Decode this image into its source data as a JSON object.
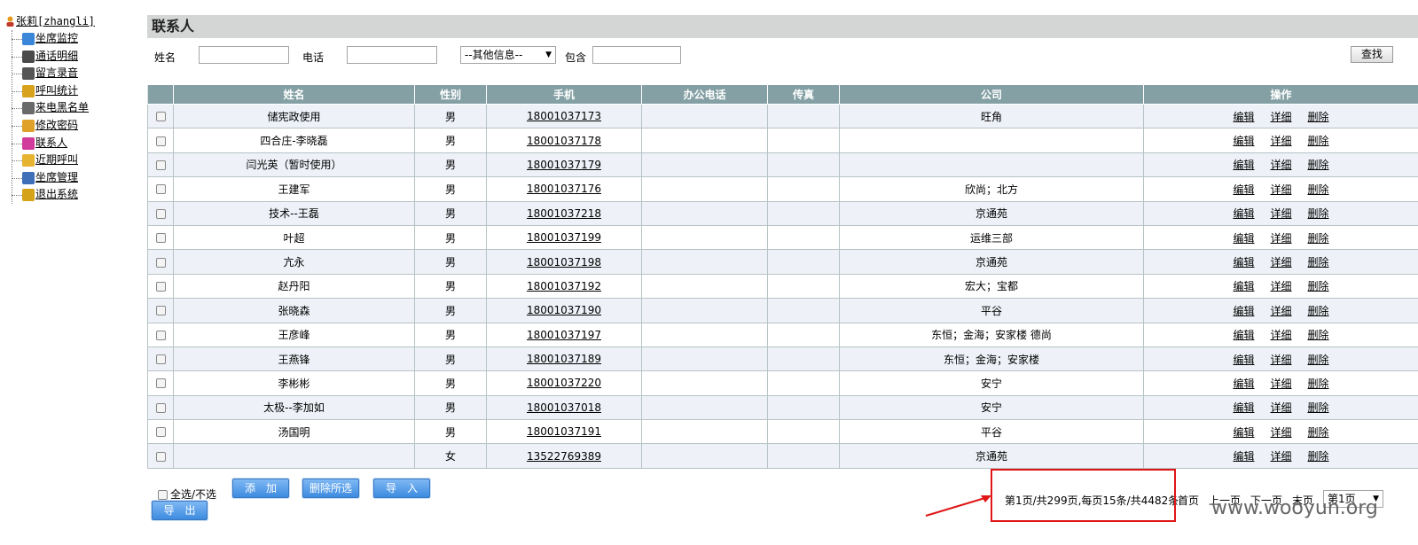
{
  "sidebar": {
    "root": "张莉[zhangli]",
    "items": [
      {
        "label": "坐席监控",
        "icon": "speaker-icon",
        "color": "#3a86d9"
      },
      {
        "label": "通话明细",
        "icon": "phone-icon",
        "color": "#4a4a4a"
      },
      {
        "label": "留言录音",
        "icon": "notebook-icon",
        "color": "#555555"
      },
      {
        "label": "呼叫统计",
        "icon": "chart-icon",
        "color": "#d9a21c"
      },
      {
        "label": "来电黑名单",
        "icon": "blacklist-icon",
        "color": "#6a6a6a"
      },
      {
        "label": "修改密码",
        "icon": "key-icon",
        "color": "#e0a12a"
      },
      {
        "label": "联系人",
        "icon": "contacts-icon",
        "color": "#d13b9c"
      },
      {
        "label": "近期呼叫",
        "icon": "folder-icon",
        "color": "#e6b430"
      },
      {
        "label": "坐席管理",
        "icon": "people-icon",
        "color": "#3f6fb8"
      },
      {
        "label": "退出系统",
        "icon": "exit-icon",
        "color": "#d4a317"
      }
    ]
  },
  "main": {
    "title": "联系人",
    "search": {
      "name_label": "姓名",
      "phone_label": "电话",
      "other_select": "--其他信息--",
      "contains_label": "包含",
      "find_button": "查找"
    },
    "table": {
      "headers": [
        "姓名",
        "性别",
        "手机",
        "办公电话",
        "传真",
        "公司",
        "操作"
      ],
      "actions": [
        "编辑",
        "详细",
        "删除"
      ],
      "rows": [
        {
          "name": "储宪政使用",
          "gender": "男",
          "mobile": "18001037173",
          "office": "",
          "fax": "",
          "company": "旺角"
        },
        {
          "name": "四合庄-李晓磊",
          "gender": "男",
          "mobile": "18001037178",
          "office": "",
          "fax": "",
          "company": ""
        },
        {
          "name": "闫光英（暂时使用）",
          "gender": "男",
          "mobile": "18001037179",
          "office": "",
          "fax": "",
          "company": ""
        },
        {
          "name": "王建军",
          "gender": "男",
          "mobile": "18001037176",
          "office": "",
          "fax": "",
          "company": "欣尚；北方"
        },
        {
          "name": "技术--王磊",
          "gender": "男",
          "mobile": "18001037218",
          "office": "",
          "fax": "",
          "company": "京通苑"
        },
        {
          "name": "叶超",
          "gender": "男",
          "mobile": "18001037199",
          "office": "",
          "fax": "",
          "company": "运维三部"
        },
        {
          "name": "亢永",
          "gender": "男",
          "mobile": "18001037198",
          "office": "",
          "fax": "",
          "company": "京通苑"
        },
        {
          "name": "赵丹阳",
          "gender": "男",
          "mobile": "18001037192",
          "office": "",
          "fax": "",
          "company": "宏大；宝都"
        },
        {
          "name": "张晓森",
          "gender": "男",
          "mobile": "18001037190",
          "office": "",
          "fax": "",
          "company": "平谷"
        },
        {
          "name": "王彦峰",
          "gender": "男",
          "mobile": "18001037197",
          "office": "",
          "fax": "",
          "company": "东恒；金海；安家楼 德尚"
        },
        {
          "name": "王燕锋",
          "gender": "男",
          "mobile": "18001037189",
          "office": "",
          "fax": "",
          "company": "东恒；金海；安家楼"
        },
        {
          "name": "李彬彬",
          "gender": "男",
          "mobile": "18001037220",
          "office": "",
          "fax": "",
          "company": "安宁"
        },
        {
          "name": "太极--李加如",
          "gender": "男",
          "mobile": "18001037018",
          "office": "",
          "fax": "",
          "company": "安宁"
        },
        {
          "name": "汤国明",
          "gender": "男",
          "mobile": "18001037191",
          "office": "",
          "fax": "",
          "company": "平谷"
        },
        {
          "name": "",
          "gender": "女",
          "mobile": "13522769389",
          "office": "",
          "fax": "",
          "company": "京通苑"
        }
      ]
    },
    "bottom": {
      "select_all": "全选/不选",
      "add_button": "添　加",
      "delete_selected_button": "删除所选",
      "import_button": "导　入",
      "export_button": "导　出"
    },
    "pager": {
      "info": "第1页/共299页,每页15条/共4482条",
      "first": "首页",
      "prev": "上一页",
      "next": "下一页",
      "last": "末页",
      "page_select": "第1页"
    }
  },
  "watermark": "www.wooyun.org",
  "colors": {
    "header_bg": "#84a0a4",
    "title_bar_bg": "#d4d5d5",
    "odd_row_bg": "#eef2f8",
    "button_blue": "#3d8be0",
    "highlight_red": "#e01616"
  }
}
